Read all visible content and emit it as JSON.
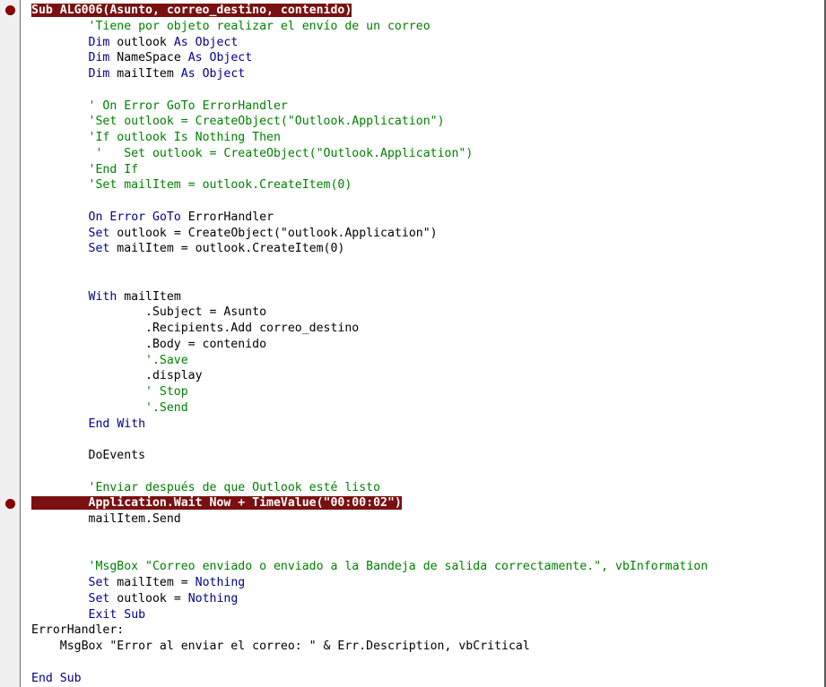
{
  "colors": {
    "keyword": "#00008b",
    "comment": "#008000",
    "breakpoint_highlight": "#7a1010",
    "breakpoint_dot": "#8b0000"
  },
  "icons": [
    "breakpoint-icon"
  ],
  "code": {
    "lines": [
      [
        "Sub ALG006(Asunto, correo_destino, contenido)"
      ],
      [
        "        ",
        "'Tiene por objeto realizar el envío de un correo"
      ],
      [
        "        ",
        "Dim",
        " outlook ",
        "As",
        " ",
        "Object"
      ],
      [
        "        ",
        "Dim",
        " NameSpace ",
        "As",
        " ",
        "Object"
      ],
      [
        "        ",
        "Dim",
        " mailItem ",
        "As",
        " ",
        "Object"
      ],
      [
        ""
      ],
      [
        "        ",
        "' On Error GoTo ErrorHandler"
      ],
      [
        "        ",
        "'Set outlook = CreateObject(\"Outlook.Application\")"
      ],
      [
        "        ",
        "'If outlook Is Nothing Then"
      ],
      [
        "        ",
        " '   Set outlook = CreateObject(\"Outlook.Application\")"
      ],
      [
        "        ",
        "'End If"
      ],
      [
        "        ",
        "'Set mailItem = outlook.CreateItem(0)"
      ],
      [
        ""
      ],
      [
        "        ",
        "On",
        " ",
        "Error",
        " ",
        "GoTo",
        " ErrorHandler"
      ],
      [
        "        ",
        "Set",
        " outlook = CreateObject(\"outlook.Application\")"
      ],
      [
        "        ",
        "Set",
        " mailItem = outlook.CreateItem(0)"
      ],
      [
        ""
      ],
      [
        ""
      ],
      [
        "        ",
        "With",
        " mailItem"
      ],
      [
        "                .Subject = Asunto"
      ],
      [
        "                .Recipients.Add correo_destino"
      ],
      [
        "                .Body = contenido"
      ],
      [
        "                ",
        "'.Save"
      ],
      [
        "                .display"
      ],
      [
        "                ",
        "' Stop"
      ],
      [
        "                ",
        "'.Send"
      ],
      [
        "        ",
        "End",
        " ",
        "With"
      ],
      [
        ""
      ],
      [
        "        DoEvents"
      ],
      [
        ""
      ],
      [
        "        ",
        "'Enviar después de que Outlook esté listo"
      ],
      [
        "        ",
        "Application.Wait Now + TimeValue(\"00:00:02\")"
      ],
      [
        "        mailItem.Send"
      ],
      [
        ""
      ],
      [
        ""
      ],
      [
        "        ",
        "'MsgBox \"Correo enviado o enviado a la Bandeja de salida correctamente.\", vbInformation"
      ],
      [
        "        ",
        "Set",
        " mailItem = ",
        "Nothing"
      ],
      [
        "        ",
        "Set",
        " outlook = ",
        "Nothing"
      ],
      [
        "        ",
        "Exit",
        " ",
        "Sub"
      ],
      [
        "ErrorHandler:"
      ],
      [
        "    MsgBox \"Error al enviar el correo: \" & Err.Description, vbCritical"
      ],
      [
        ""
      ],
      [
        "End",
        " ",
        "Sub"
      ]
    ]
  }
}
